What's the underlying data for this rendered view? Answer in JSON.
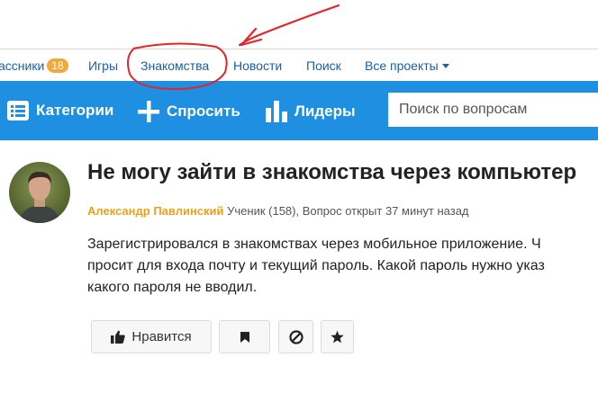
{
  "topnav": {
    "items": [
      {
        "label": "ассники",
        "badge": "18"
      },
      {
        "label": "Игры"
      },
      {
        "label": "Знакомства"
      },
      {
        "label": "Новости"
      },
      {
        "label": "Поиск"
      },
      {
        "label": "Все проекты"
      }
    ]
  },
  "toolbar": {
    "categories": "Категории",
    "ask": "Спросить",
    "leaders": "Лидеры",
    "search_placeholder": "Поиск по вопросам"
  },
  "question": {
    "title": "Не могу зайти в знакомства через компьютер",
    "author": "Александр Павлинский",
    "meta": " Ученик (158), Вопрос открыт 37 минут назад",
    "body": [
      "Зарегистрировался в знакомствах через мобильное приложение. Ч",
      "просит для входа почту и текущий пароль. Какой пароль нужно указ",
      "какого пароля не вводил."
    ]
  },
  "actions": {
    "like_label": "Нравится"
  },
  "colors": {
    "accent": "#1e8fe1",
    "link": "#1a5fa8",
    "author": "#e8a21f",
    "badge": "#f0a93a",
    "annotation": "#e3242b"
  }
}
